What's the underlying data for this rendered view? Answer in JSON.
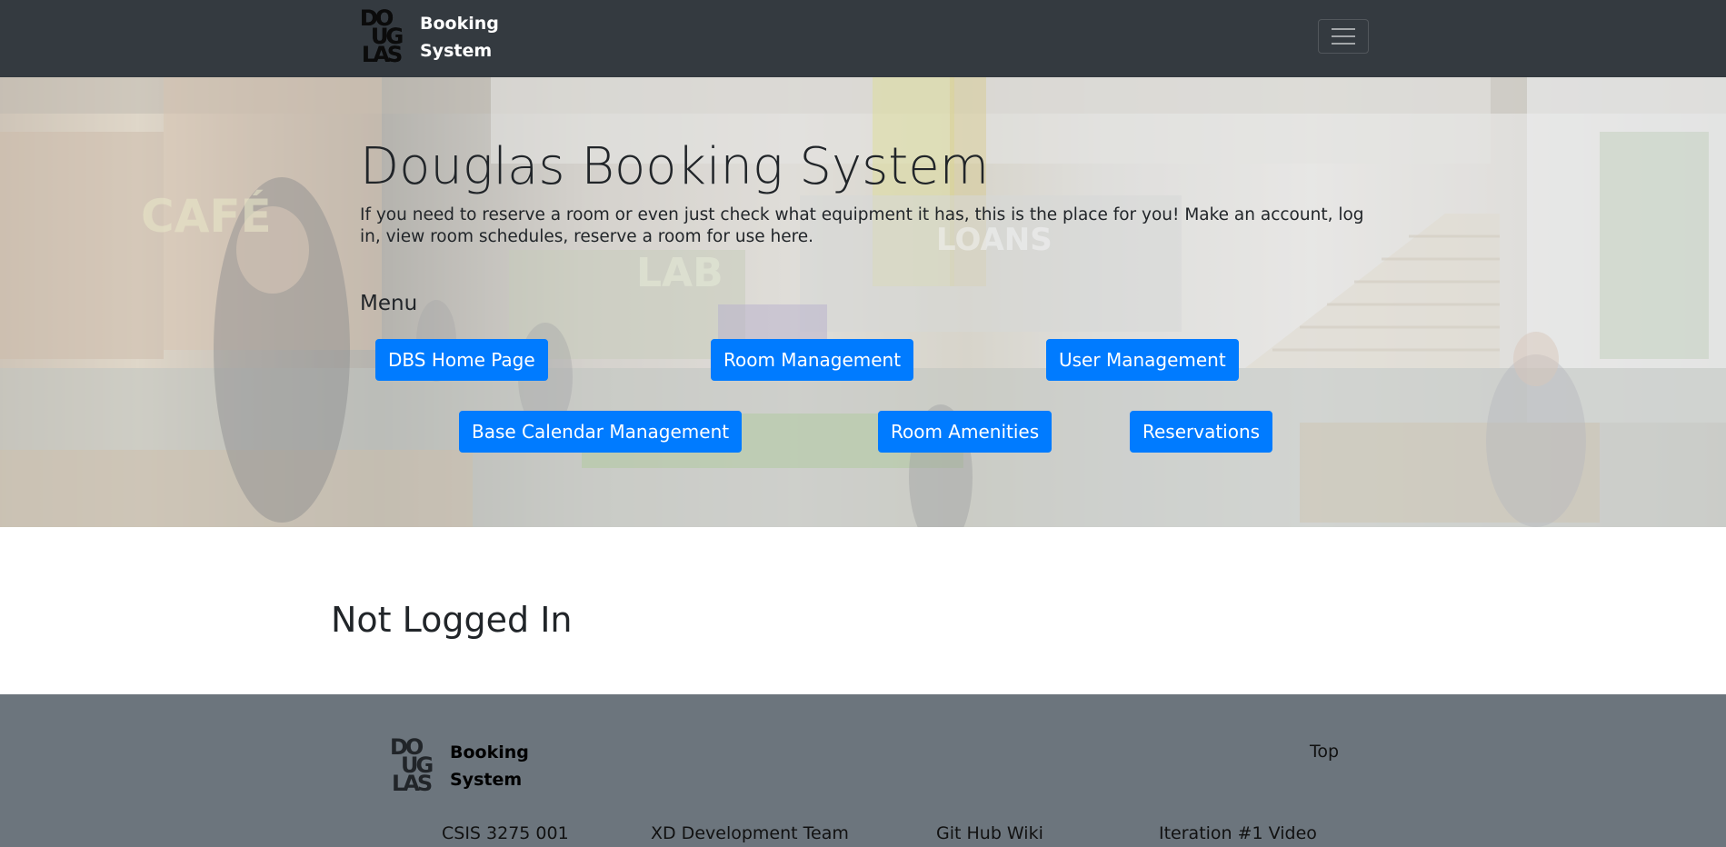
{
  "navbar": {
    "logo_text": [
      "DO",
      "UG",
      "LAS"
    ],
    "brand": "Booking System",
    "toggler_icon": "hamburger-menu-icon"
  },
  "hero": {
    "title": "Douglas Booking System",
    "lead": "If you need to reserve a room or even just check what equipment it has, this is the place for you! Make an account, log in, view room schedules, reserve a room for use here.",
    "menu_heading": "Menu",
    "buttons": [
      "DBS Home Page",
      "Room Management",
      "User Management",
      "Base Calendar Management",
      "Room Amenities",
      "Reservations"
    ],
    "photo_sign_texts": [
      "CAFÉ",
      "LOANS",
      "LAB"
    ]
  },
  "main": {
    "status": "Not Logged In"
  },
  "footer": {
    "logo_text": [
      "DO",
      "UG",
      "LAS"
    ],
    "brand": "Booking System",
    "top_link": "Top",
    "links": [
      "CSIS 3275 001",
      "XD Development Team",
      "Git Hub Wiki",
      "Iteration #1 Video"
    ]
  },
  "colors": {
    "navbar_bg": "#343a40",
    "primary_button": "#007bff",
    "footer_bg": "#6c757d"
  }
}
